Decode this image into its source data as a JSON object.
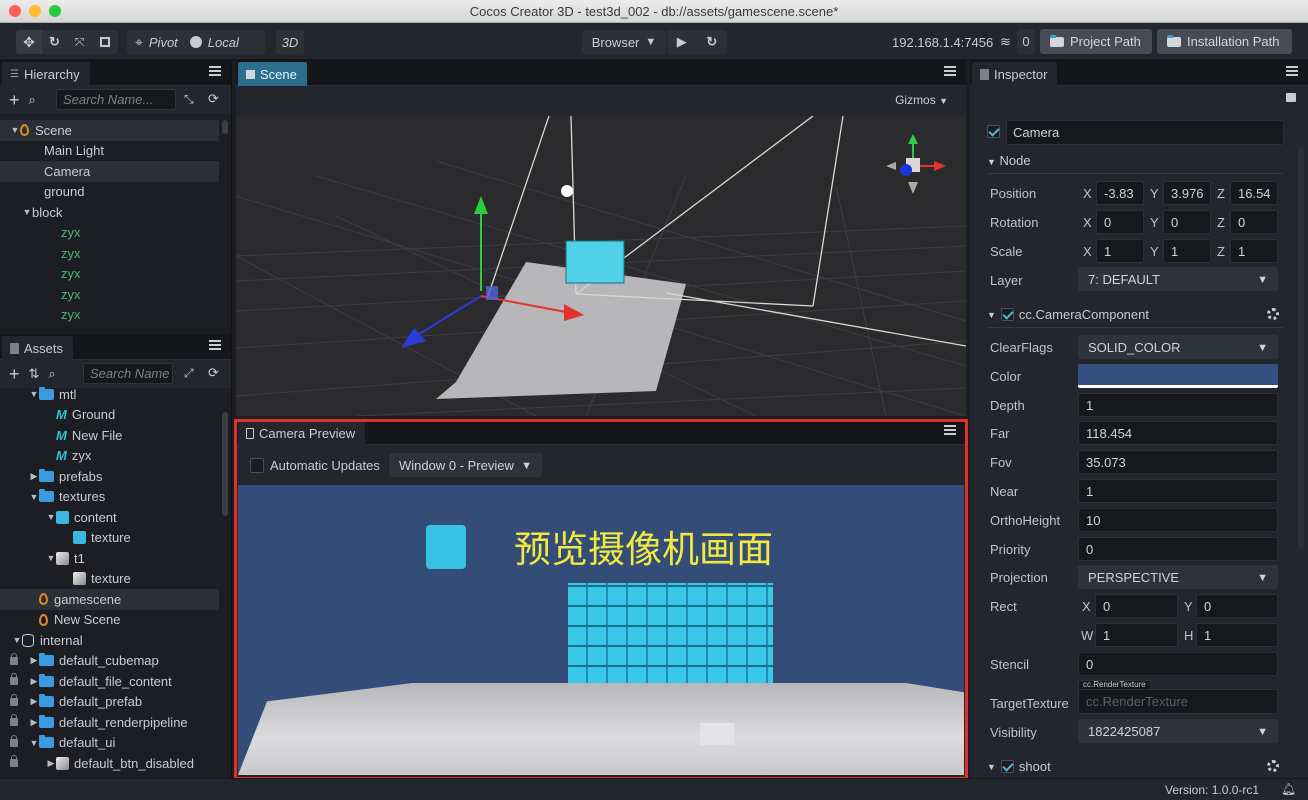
{
  "window": {
    "title": "Cocos Creator 3D - test3d_002 - db://assets/gamescene.scene*"
  },
  "toolbar": {
    "transform_tools": [
      "move-icon",
      "rotate-icon",
      "scale-icon",
      "rect-icon"
    ],
    "pivot_label": "Pivot",
    "local_label": "Local",
    "mode_3d_label": "3D",
    "browser_label": "Browser",
    "play_icon": "play-icon",
    "refresh_icon": "refresh-icon",
    "ip_address": "192.168.1.4:7456",
    "connection_count": "0",
    "project_path_label": "Project Path",
    "installation_path_label": "Installation Path"
  },
  "hierarchy": {
    "tab_label": "Hierarchy",
    "search_placeholder": "Search Name...",
    "nodes": [
      {
        "label": "Scene",
        "depth": 0,
        "expanded": true,
        "type": "scene"
      },
      {
        "label": "Main Light",
        "depth": 1
      },
      {
        "label": "Camera",
        "depth": 1,
        "selected": true
      },
      {
        "label": "ground",
        "depth": 1
      },
      {
        "label": "block",
        "depth": 1,
        "expanded": true
      },
      {
        "label": "zyx",
        "depth": 2,
        "prefab": true
      },
      {
        "label": "zyx",
        "depth": 2,
        "prefab": true
      },
      {
        "label": "zyx",
        "depth": 2,
        "prefab": true
      },
      {
        "label": "zyx",
        "depth": 2,
        "prefab": true
      },
      {
        "label": "zyx",
        "depth": 2,
        "prefab": true
      }
    ]
  },
  "assets": {
    "tab_label": "Assets",
    "search_placeholder": "Search Name",
    "items": [
      {
        "label": "mtl",
        "depth": 1,
        "type": "folder",
        "expanded": true
      },
      {
        "label": "Ground",
        "depth": 2,
        "type": "material"
      },
      {
        "label": "New File",
        "depth": 2,
        "type": "material"
      },
      {
        "label": "zyx",
        "depth": 2,
        "type": "material"
      },
      {
        "label": "prefabs",
        "depth": 1,
        "type": "folder",
        "expanded": false
      },
      {
        "label": "textures",
        "depth": 1,
        "type": "folder",
        "expanded": true
      },
      {
        "label": "content",
        "depth": 2,
        "type": "image",
        "expanded": true
      },
      {
        "label": "texture",
        "depth": 3,
        "type": "texture-cyan"
      },
      {
        "label": "t1",
        "depth": 2,
        "type": "image-gray",
        "expanded": true
      },
      {
        "label": "texture",
        "depth": 3,
        "type": "texture-gray"
      },
      {
        "label": "gamescene",
        "depth": 1,
        "type": "scene",
        "selected": true
      },
      {
        "label": "New Scene",
        "depth": 1,
        "type": "scene"
      },
      {
        "label": "internal",
        "depth": 0,
        "type": "db",
        "expanded": true
      },
      {
        "label": "default_cubemap",
        "depth": 1,
        "type": "folder",
        "expanded": false,
        "locked": true
      },
      {
        "label": "default_file_content",
        "depth": 1,
        "type": "folder",
        "expanded": false,
        "locked": true
      },
      {
        "label": "default_prefab",
        "depth": 1,
        "type": "folder",
        "expanded": false,
        "locked": true
      },
      {
        "label": "default_renderpipeline",
        "depth": 1,
        "type": "folder",
        "expanded": false,
        "locked": true
      },
      {
        "label": "default_ui",
        "depth": 1,
        "type": "folder",
        "expanded": true,
        "locked": true
      },
      {
        "label": "default_btn_disabled",
        "depth": 2,
        "type": "image-gray",
        "expanded": false,
        "locked": true
      }
    ]
  },
  "scene": {
    "tab_label": "Scene",
    "gizmos_label": "Gizmos"
  },
  "camera_preview": {
    "tab_label": "Camera Preview",
    "automatic_updates_label": "Automatic Updates",
    "automatic_updates_checked": false,
    "window_select": "Window 0 - Preview",
    "overlay_text": "预览摄像机画面",
    "background_color": "#344d78"
  },
  "inspector": {
    "tab_label": "Inspector",
    "node_name": "Camera",
    "node_enabled": true,
    "node_section": "Node",
    "position": {
      "label": "Position",
      "x": "-3.83",
      "y": "3.976",
      "z": "16.54"
    },
    "rotation": {
      "label": "Rotation",
      "x": "0",
      "y": "0",
      "z": "0"
    },
    "scale": {
      "label": "Scale",
      "x": "1",
      "y": "1",
      "z": "1"
    },
    "layer": {
      "label": "Layer",
      "value": "7: DEFAULT"
    },
    "component": {
      "name": "cc.CameraComponent",
      "enabled": true,
      "clear_flags": {
        "label": "ClearFlags",
        "value": "SOLID_COLOR"
      },
      "color": {
        "label": "Color",
        "value": "#33507e"
      },
      "depth": {
        "label": "Depth",
        "value": "1"
      },
      "far": {
        "label": "Far",
        "value": "118.454"
      },
      "fov": {
        "label": "Fov",
        "value": "35.073"
      },
      "near": {
        "label": "Near",
        "value": "1"
      },
      "ortho_height": {
        "label": "OrthoHeight",
        "value": "10"
      },
      "priority": {
        "label": "Priority",
        "value": "0"
      },
      "projection": {
        "label": "Projection",
        "value": "PERSPECTIVE"
      },
      "rect": {
        "label": "Rect",
        "x": "0",
        "y": "0",
        "w": "1",
        "h": "1"
      },
      "stencil": {
        "label": "Stencil",
        "value": "0"
      },
      "target_texture": {
        "label": "TargetTexture",
        "type_tag": "cc.RenderTexture",
        "placeholder": "cc.RenderTexture"
      },
      "visibility": {
        "label": "Visibility",
        "value": "1822425087"
      }
    },
    "component2": {
      "name": "shoot",
      "enabled": true
    },
    "axis": {
      "x": "X",
      "y": "Y",
      "z": "Z",
      "w": "W",
      "h": "H"
    }
  },
  "status": {
    "version": "Version: 1.0.0-rc1"
  }
}
